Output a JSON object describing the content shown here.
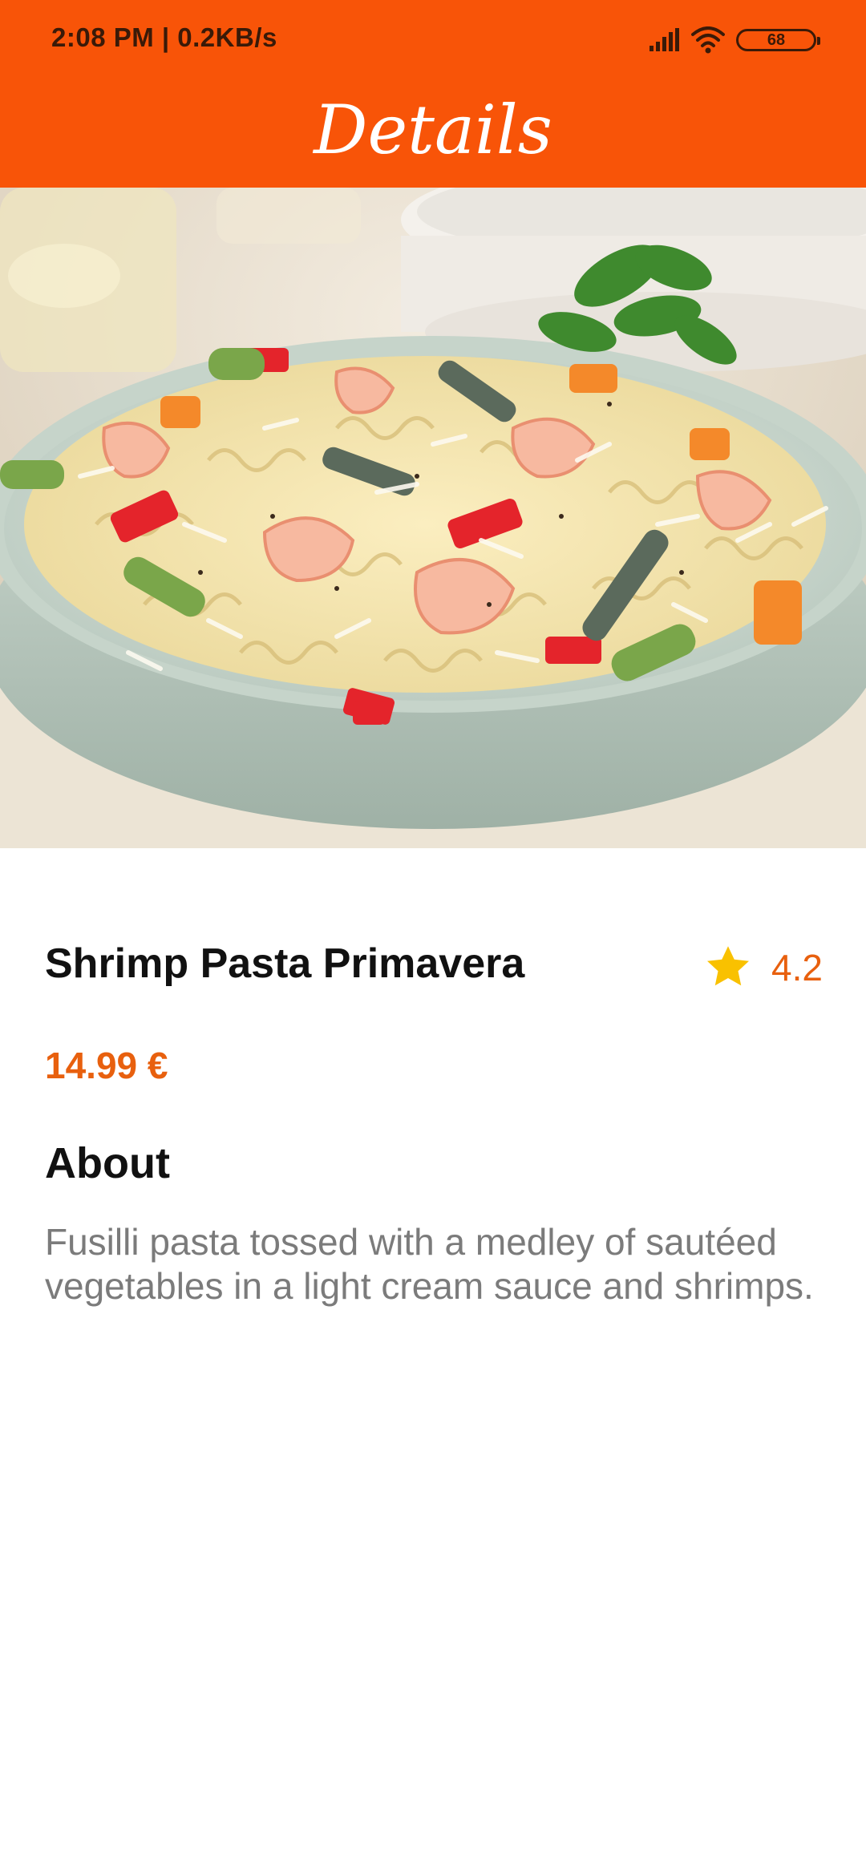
{
  "status_bar": {
    "time_speed": "2:08 PM | 0.2KB/s",
    "signal_icon": "signal-bars-icon",
    "wifi_icon": "wifi-icon",
    "battery_level": "68"
  },
  "header": {
    "title": "Details"
  },
  "hero": {
    "image": "shrimp-pasta-bowl-photo"
  },
  "dish": {
    "name": "Shrimp Pasta Primavera",
    "rating_icon": "star-icon",
    "rating": "4.2",
    "price": "14.99 €"
  },
  "about": {
    "heading": "About",
    "text": "Fusilli pasta tossed with a medley of sautéed vegetables in a light cream sauce and shrimps."
  },
  "colors": {
    "accent": "#f85408",
    "price": "#e8600e",
    "star": "#f9c100",
    "description": "#7b7b7b"
  }
}
